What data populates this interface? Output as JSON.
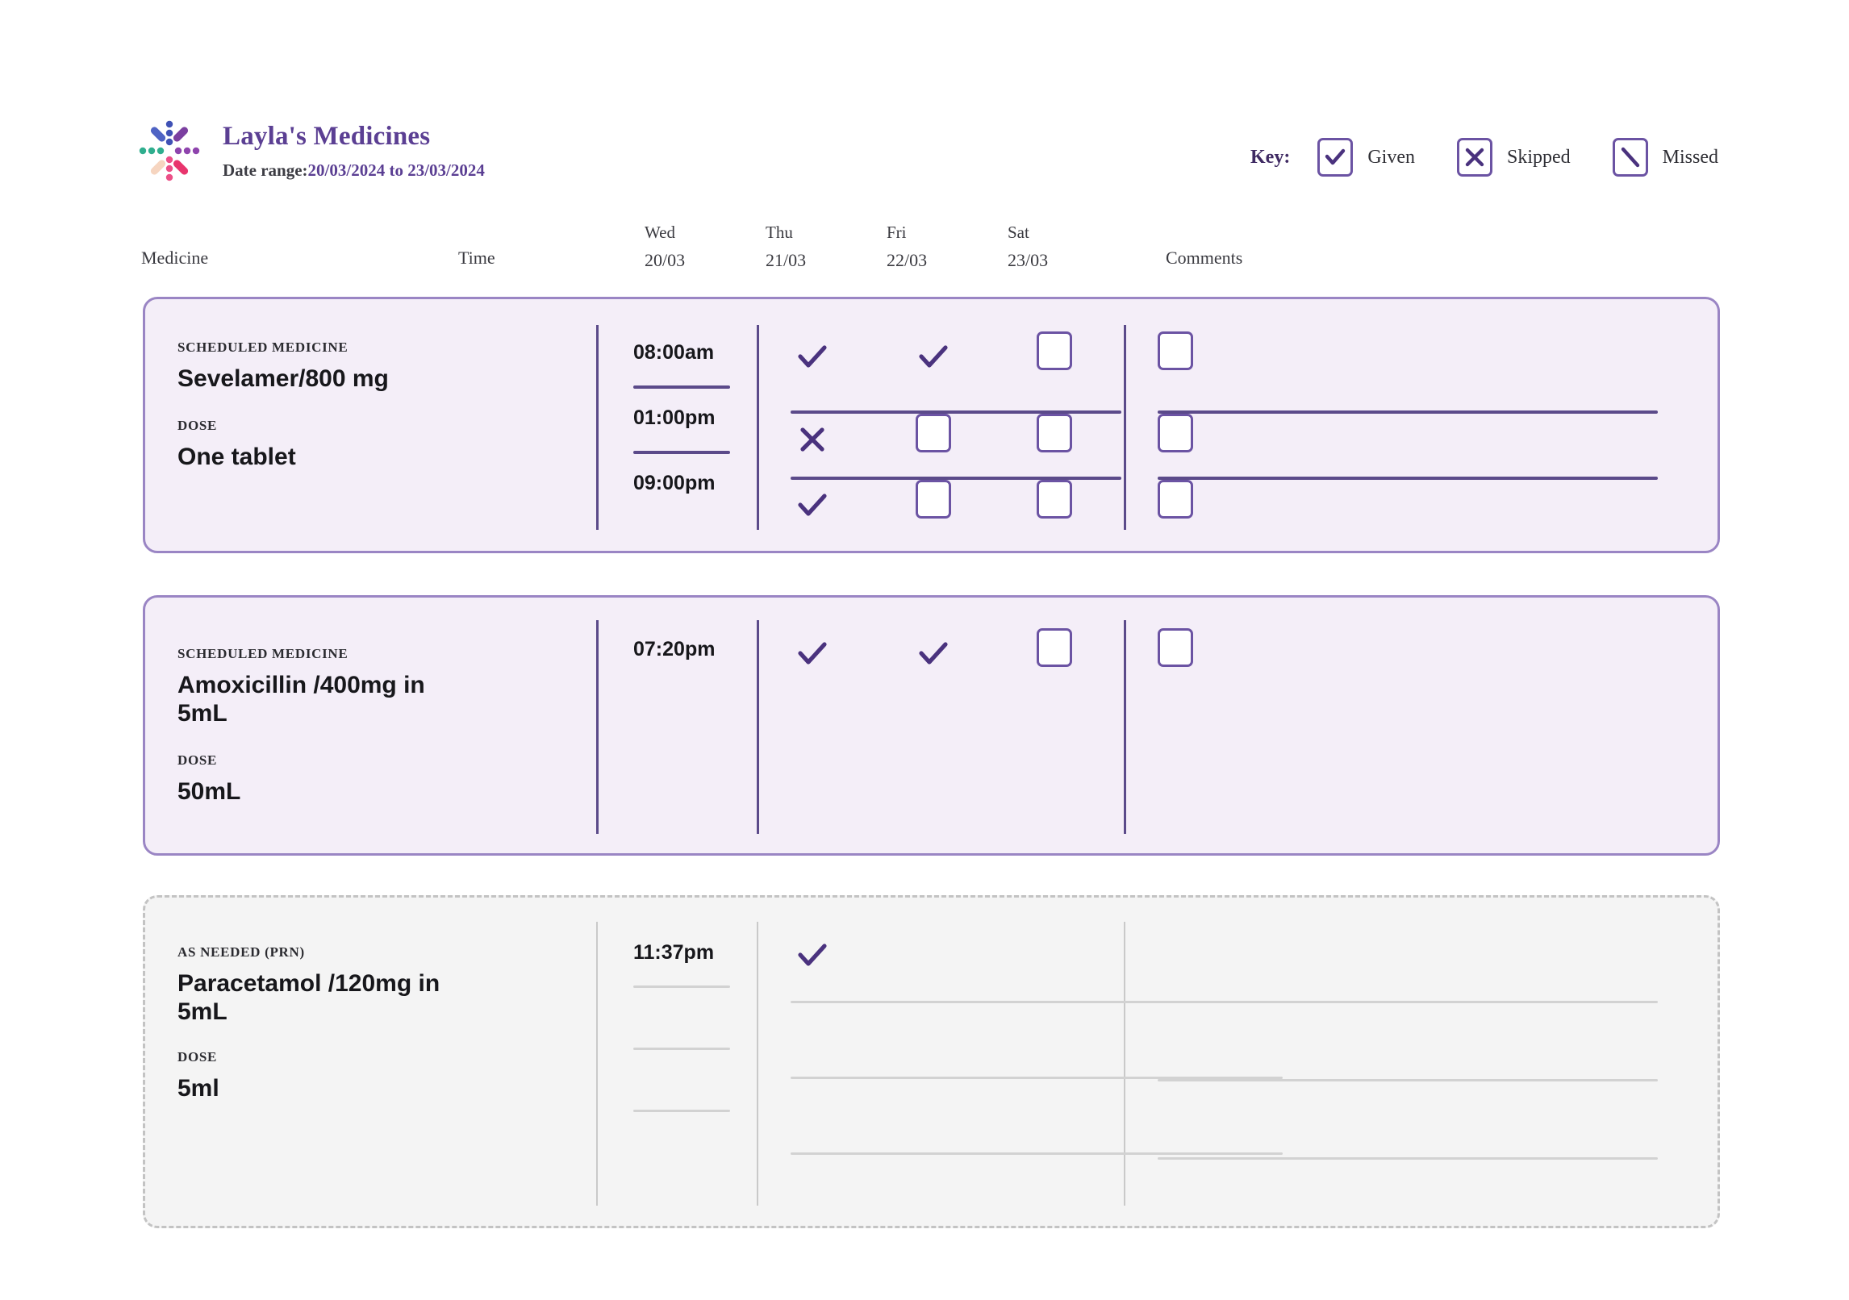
{
  "header": {
    "app_title": "Layla's Medicines",
    "date_label": "Date range:",
    "date_value": "20/03/2024 to 23/03/2024",
    "logo_icon": "pill-starburst-logo"
  },
  "key": {
    "label": "Key:",
    "items": [
      {
        "state": "given",
        "icon": "check-icon",
        "label": "Given"
      },
      {
        "state": "skipped",
        "icon": "cross-icon",
        "label": "Skipped"
      },
      {
        "state": "missed",
        "icon": "diagonal-icon",
        "label": "Missed"
      }
    ]
  },
  "columns": {
    "medicine": "Medicine",
    "time": "Time",
    "comments": "Comments",
    "days": [
      {
        "dow": "Wed",
        "date": "20/03"
      },
      {
        "dow": "Thu",
        "date": "21/03"
      },
      {
        "dow": "Fri",
        "date": "22/03"
      },
      {
        "dow": "Sat",
        "date": "23/03"
      }
    ]
  },
  "labels": {
    "scheduled": "SCHEDULED MEDICINE",
    "prn": "AS NEEDED (PRN)",
    "dose": "DOSE"
  },
  "cards": [
    {
      "kind": "scheduled",
      "kicker": "SCHEDULED MEDICINE",
      "name": "Sevelamer/800 mg",
      "dose_kicker": "DOSE",
      "dose": "One tablet",
      "rows": [
        {
          "time": "08:00am",
          "days": [
            "given",
            "given",
            "empty",
            "empty"
          ],
          "comment": ""
        },
        {
          "time": "01:00pm",
          "days": [
            "skipped",
            "empty",
            "empty",
            "empty"
          ],
          "comment": ""
        },
        {
          "time": "09:00pm",
          "days": [
            "given",
            "empty",
            "empty",
            "empty"
          ],
          "comment": ""
        }
      ]
    },
    {
      "kind": "scheduled",
      "kicker": "SCHEDULED MEDICINE",
      "name": "Amoxicillin /400mg in 5mL",
      "dose_kicker": "DOSE",
      "dose": "50mL",
      "rows": [
        {
          "time": "07:20pm",
          "days": [
            "given",
            "given",
            "empty",
            "empty"
          ],
          "comment": ""
        }
      ]
    },
    {
      "kind": "prn",
      "kicker": "AS NEEDED (PRN)",
      "name": "Paracetamol /120mg in 5mL",
      "dose_kicker": "DOSE",
      "dose": "5ml",
      "rows": [
        {
          "time": "11:37pm",
          "days": [
            "given"
          ],
          "comment": ""
        },
        {
          "time": "",
          "days": [],
          "comment": ""
        },
        {
          "time": "",
          "days": [],
          "comment": ""
        },
        {
          "time": "",
          "days": [],
          "comment": ""
        }
      ]
    }
  ],
  "colors": {
    "brand_purple": "#5b3f93",
    "mark_purple": "#4a327e",
    "box_border": "#6b53a3",
    "card_bg": "#f4eef8",
    "card_border": "#9a85c4",
    "prn_bg": "#f4f4f4",
    "prn_border": "#c3c3c3",
    "rule_purple": "#5b4a8a",
    "rule_gray": "#d2d2d2"
  }
}
